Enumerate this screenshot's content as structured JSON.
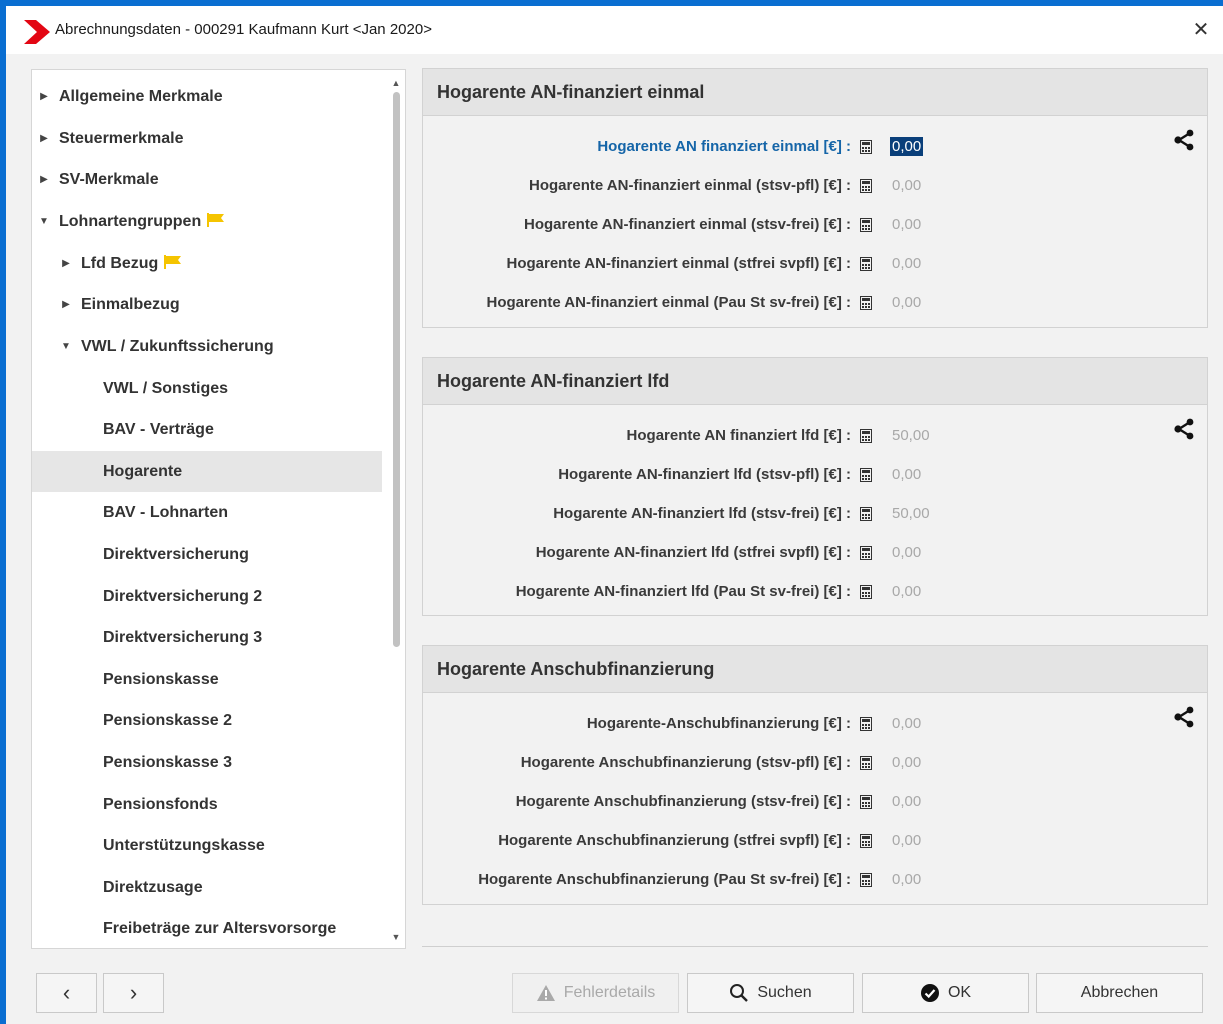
{
  "window": {
    "title": "Abrechnungsdaten - 000291 Kaufmann Kurt <Jan 2020>",
    "close_glyph": "✕",
    "accent_color": "#0a6ed1",
    "logo_color": "#e30613"
  },
  "tree": {
    "items": [
      {
        "label": "Allgemeine Merkmale",
        "arrow": "▶"
      },
      {
        "label": "Steuermerkmale",
        "arrow": "▶"
      },
      {
        "label": "SV-Merkmale",
        "arrow": "▶"
      },
      {
        "label": "Lohnartengruppen",
        "arrow": "▼"
      },
      {
        "label": "Lfd Bezug",
        "arrow": "▶"
      },
      {
        "label": "Einmalbezug",
        "arrow": "▶"
      },
      {
        "label": "VWL / Zukunftssicherung",
        "arrow": "▼"
      },
      {
        "label": "VWL / Sonstiges"
      },
      {
        "label": "BAV - Verträge"
      },
      {
        "label": "Hogarente"
      },
      {
        "label": "BAV - Lohnarten"
      },
      {
        "label": "Direktversicherung"
      },
      {
        "label": "Direktversicherung 2"
      },
      {
        "label": "Direktversicherung 3"
      },
      {
        "label": "Pensionskasse"
      },
      {
        "label": "Pensionskasse 2"
      },
      {
        "label": "Pensionskasse 3"
      },
      {
        "label": "Pensionsfonds"
      },
      {
        "label": "Unterstützungskasse"
      },
      {
        "label": "Direktzusage"
      },
      {
        "label": "Freibeträge zur Altersvorsorge"
      }
    ],
    "flag_color": "#f5c400",
    "scroll_up": "▲",
    "scroll_down": "▼"
  },
  "sections": [
    {
      "title": "Hogarente AN-finanziert einmal",
      "fields": [
        {
          "label": "Hogarente AN finanziert einmal  [€] :",
          "value": "0,00"
        },
        {
          "label": "Hogarente AN-finanziert einmal (stsv-pfl) [€] :",
          "value": "0,00"
        },
        {
          "label": "Hogarente AN-finanziert einmal (stsv-frei) [€] :",
          "value": "0,00"
        },
        {
          "label": "Hogarente AN-finanziert einmal (stfrei svpfl) [€] :",
          "value": "0,00"
        },
        {
          "label": "Hogarente AN-finanziert einmal (Pau St sv-frei) [€] :",
          "value": "0,00"
        }
      ]
    },
    {
      "title": "Hogarente AN-finanziert lfd",
      "fields": [
        {
          "label": "Hogarente AN finanziert lfd [€] :",
          "value": "50,00"
        },
        {
          "label": "Hogarente AN-finanziert lfd (stsv-pfl) [€] :",
          "value": "0,00"
        },
        {
          "label": "Hogarente AN-finanziert lfd (stsv-frei) [€] :",
          "value": "50,00"
        },
        {
          "label": "Hogarente AN-finanziert lfd (stfrei svpfl) [€] :",
          "value": "0,00"
        },
        {
          "label": "Hogarente AN-finanziert lfd (Pau St sv-frei) [€] :",
          "value": "0,00"
        }
      ]
    },
    {
      "title": "Hogarente Anschubfinanzierung",
      "fields": [
        {
          "label": "Hogarente-Anschubfinanzierung [€] :",
          "value": "0,00"
        },
        {
          "label": "Hogarente Anschubfinanzierung (stsv-pfl) [€] :",
          "value": "0,00"
        },
        {
          "label": "Hogarente Anschubfinanzierung (stsv-frei) [€] :",
          "value": "0,00"
        },
        {
          "label": "Hogarente Anschubfinanzierung (stfrei svpfl) [€] :",
          "value": "0,00"
        },
        {
          "label": "Hogarente Anschubfinanzierung (Pau St sv-frei) [€] :",
          "value": "0,00"
        }
      ]
    }
  ],
  "buttons": {
    "prev": "‹",
    "next": "›",
    "fehlerdetails": "Fehlerdetails",
    "suchen": "Suchen",
    "ok": "OK",
    "abbrechen": "Abbrechen"
  }
}
